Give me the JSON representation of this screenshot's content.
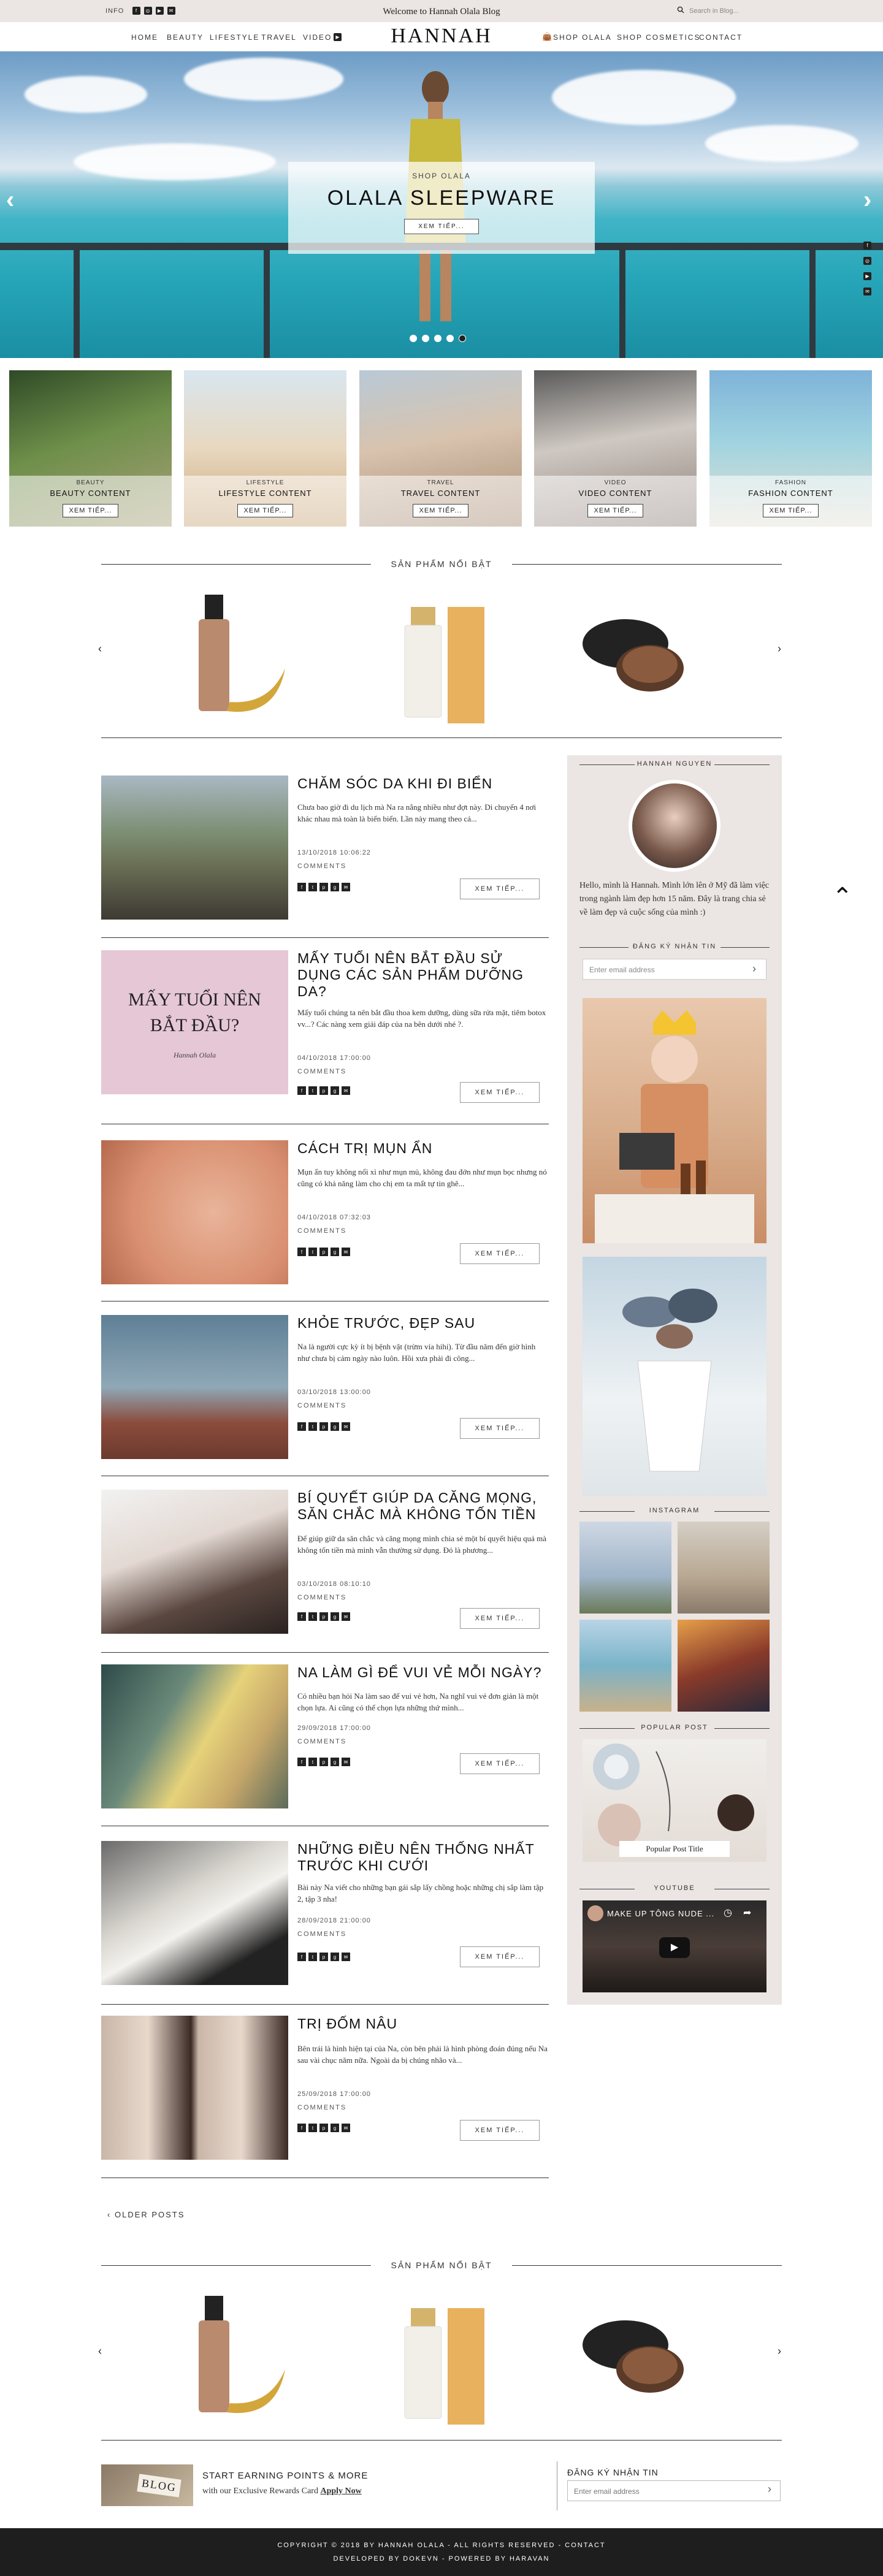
{
  "topbar": {
    "info": "INFO",
    "welcome": "Welcome to Hannah Olala Blog",
    "search_placeholder": "Search in Blog..."
  },
  "nav": {
    "left": [
      "HOME",
      "BEAUTY",
      "LIFESTYLE",
      "TRAVEL",
      "VIDEO"
    ],
    "logo": "HANNAH OLALA",
    "right": [
      "SHOP OLALA",
      "SHOP COSMETICS",
      "CONTACT"
    ]
  },
  "hero": {
    "kicker": "SHOP OLALA",
    "title": "OLALA SLEEPWARE",
    "button": "XEM TIẾP...",
    "slide_count": 5,
    "active_slide": 5
  },
  "categories": [
    {
      "kicker": "BEAUTY",
      "title": "BEAUTY CONTENT",
      "button": "XEM TIẾP..."
    },
    {
      "kicker": "LIFESTYLE",
      "title": "LIFESTYLE CONTENT",
      "button": "XEM TIẾP..."
    },
    {
      "kicker": "TRAVEL",
      "title": "TRAVEL CONTENT",
      "button": "XEM TIẾP..."
    },
    {
      "kicker": "VIDEO",
      "title": "VIDEO CONTENT",
      "button": "XEM TIẾP..."
    },
    {
      "kicker": "FASHION",
      "title": "FASHION CONTENT",
      "button": "XEM TIẾP..."
    }
  ],
  "featured": {
    "heading": "SẢN PHẨM NỔI BẬT"
  },
  "posts": [
    {
      "title": "CHĂM SÓC DA KHI ĐI BIỂN",
      "excerpt": "Chưa bao giờ đi du lịch mà Na ra nắng nhiều như đợt này. Di chuyển 4 nơi khác nhau mà toàn là biển biển. Lần này mang theo cả...",
      "date": "13/10/2018 10:06:22",
      "comments": "COMMENTS",
      "more": "XEM TIẾP..."
    },
    {
      "title": "MẤY TUỔI NÊN BẮT ĐẦU SỬ DỤNG CÁC SẢN PHẨM DƯỠNG DA?",
      "excerpt": "Mấy tuổi chúng ta nên bắt đầu thoa kem dưỡng, dùng sữa rửa mặt, tiêm botox vv...? Các nàng xem giải đáp của na bên dưới nhé ?.",
      "date": "04/10/2018 17:00:00",
      "comments": "COMMENTS",
      "more": "XEM TIẾP...",
      "img_text": "MẤY TUỔI NÊN BẮT ĐẦU?",
      "img_sig": "Hannah Olala"
    },
    {
      "title": "CÁCH TRỊ MỤN ẨN",
      "excerpt": "Mụn ẩn tuy không nổi xì như mụn mủ, không đau đớn như mụn bọc nhưng nó cũng có khả năng làm cho chị em ta mất tự tin ghê...",
      "date": "04/10/2018 07:32:03",
      "comments": "COMMENTS",
      "more": "XEM TIẾP..."
    },
    {
      "title": "KHỎE TRƯỚC, ĐẸP SAU",
      "excerpt": "Na là người cực kỳ ít bị bệnh vặt (trừm vía hihi). Từ đầu năm đến giờ hình như chưa bị cảm ngày nào luôn. Hồi xưa phải đi công...",
      "date": "03/10/2018 13:00:00",
      "comments": "COMMENTS",
      "more": "XEM TIẾP..."
    },
    {
      "title": "BÍ QUYẾT GIÚP DA CĂNG MỌNG, SĂN CHẮC MÀ KHÔNG TỐN TIỀN",
      "excerpt": "Để giúp giữ da săn chắc và căng mọng mình chia sẻ một bí quyết hiệu quả mà không tốn tiền mà mình vẫn thường sử dụng. Đó là phương...",
      "date": "03/10/2018 08:10:10",
      "comments": "COMMENTS",
      "more": "XEM TIẾP..."
    },
    {
      "title": "NA LÀM GÌ ĐỂ VUI VẺ MỖI NGÀY?",
      "excerpt": "Có nhiều bạn hỏi Na làm sao để vui vẻ hơn, Na nghĩ vui vẻ đơn giản là một chọn lựa. Ai cũng có thể chọn lựa những thứ mình...",
      "date": "29/09/2018 17:00:00",
      "comments": "COMMENTS",
      "more": "XEM TIẾP..."
    },
    {
      "title": "NHỮNG ĐIỀU NÊN THỐNG NHẤT TRƯỚC KHI CƯỚI",
      "excerpt": "Bài này Na viết cho những bạn gái sắp lấy chồng hoặc những chị sắp làm tập 2, tập 3 nha!",
      "date": "28/09/2018 21:00:00",
      "comments": "COMMENTS",
      "more": "XEM TIẾP..."
    },
    {
      "title": "TRỊ ĐỐM NÂU",
      "excerpt": "Bên trái là hình hiện tại của Na, còn bên phải là hình phòng đoán đúng nếu Na sau vài chục năm nữa. Ngoài da bị chúng nhão và...",
      "date": "25/09/2018 17:00:00",
      "comments": "COMMENTS",
      "more": "XEM TIẾP..."
    }
  ],
  "older_posts": "OLDER POSTS",
  "sidebar": {
    "author_heading": "HANNAH NGUYEN",
    "bio": "Hello, mình là Hannah. Mình lớn lên ở Mỹ đã làm việc trong ngành làm đẹp hơn 15 năm. Đây là trang chia sẻ về làm đẹp và cuộc sống của mình :)",
    "subscribe_heading": "ĐĂNG KÝ NHẬN TIN",
    "email_placeholder": "Enter email address",
    "instagram_heading": "INSTAGRAM",
    "popular_heading": "POPULAR POST",
    "popular_title": "Popular Post Title",
    "youtube_heading": "YOUTUBE",
    "video_title": "MAKE UP TÔNG NUDE ..."
  },
  "featured_bottom": {
    "heading": "SẢN PHẨM NỔI BẬT"
  },
  "rewards": {
    "img_text": "BLOG",
    "title": "START EARNING POINTS & MORE",
    "line": "with our Exclusive Rewards Card",
    "link": "Apply Now"
  },
  "newsletter": {
    "heading": "ĐĂNG KÝ NHẬN TIN",
    "placeholder": "Enter email address"
  },
  "footer": {
    "line1": "COPYRIGHT © 2018 BY HANNAH OLALA - ALL RIGHTS RESERVED -",
    "contact": "CONTACT",
    "line2": "DEVELOPED BY DOKEVN - POWERED BY HARAVAN"
  },
  "colors": {
    "accent": "#ebe5e3",
    "dark": "#1e1e1e"
  },
  "icons": [
    "facebook-icon",
    "instagram-icon",
    "youtube-icon",
    "mail-icon",
    "search-icon",
    "video-icon",
    "bag-icon",
    "chevron-up-icon"
  ]
}
